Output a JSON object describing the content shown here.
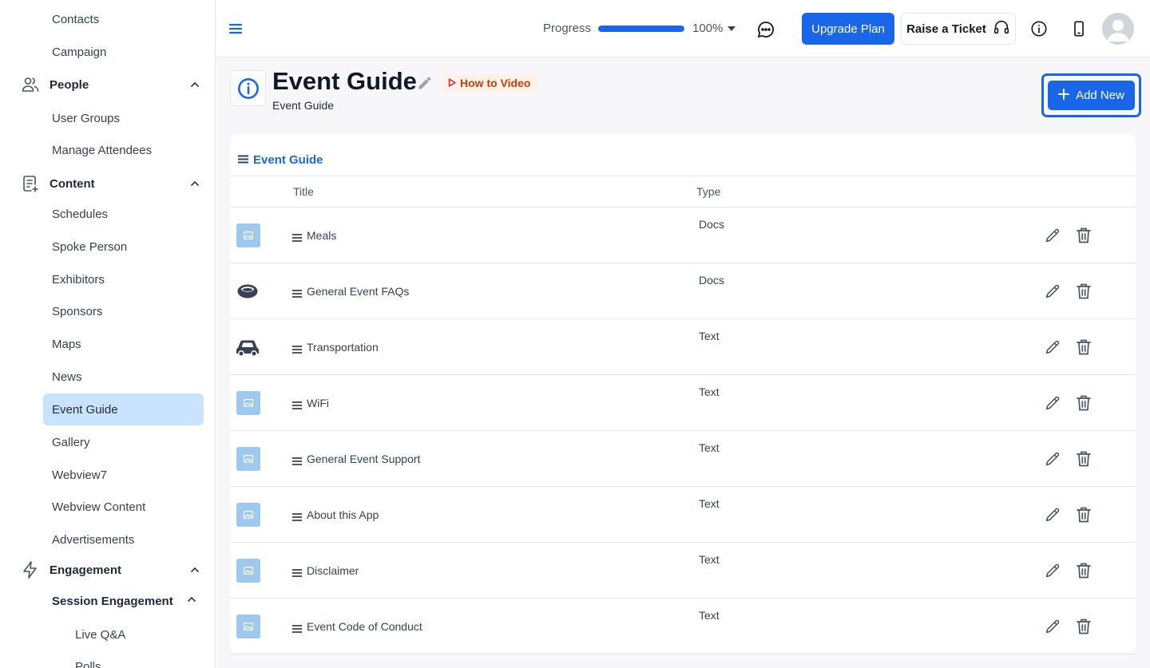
{
  "sidebar": {
    "top_items": [
      "Contacts",
      "Campaign"
    ],
    "people": {
      "label": "People",
      "icon": "users-icon",
      "items": [
        "User Groups",
        "Manage Attendees"
      ]
    },
    "content": {
      "label": "Content",
      "icon": "document-add-icon",
      "items": [
        "Schedules",
        "Spoke Person",
        "Exhibitors",
        "Sponsors",
        "Maps",
        "News",
        "Event Guide",
        "Gallery",
        "Webview7",
        "Webview Content",
        "Advertisements"
      ],
      "active": "Event Guide"
    },
    "engagement": {
      "label": "Engagement",
      "icon": "lightning-icon",
      "sub": {
        "label": "Session Engagement",
        "items": [
          "Live Q&A",
          "Polls"
        ]
      }
    }
  },
  "topbar": {
    "progress_label": "Progress",
    "progress_value": 100,
    "progress_text": "100%",
    "upgrade_label": "Upgrade Plan",
    "ticket_label": "Raise a Ticket"
  },
  "page": {
    "title": "Event Guide",
    "subtitle": "Event Guide",
    "how_to_label": "How to Video",
    "add_new_label": "Add New"
  },
  "table": {
    "section_title": "Event Guide",
    "columns": {
      "title": "Title",
      "type": "Type"
    },
    "rows": [
      {
        "title": "Meals",
        "type": "Docs",
        "icon": "image-placeholder-icon"
      },
      {
        "title": "General Event FAQs",
        "type": "Docs",
        "icon": "ring-icon"
      },
      {
        "title": "Transportation",
        "type": "Text",
        "icon": "car-icon"
      },
      {
        "title": "WiFi",
        "type": "Text",
        "icon": "image-placeholder-icon"
      },
      {
        "title": "General Event Support",
        "type": "Text",
        "icon": "image-placeholder-icon"
      },
      {
        "title": "About this App",
        "type": "Text",
        "icon": "image-placeholder-icon"
      },
      {
        "title": "Disclaimer",
        "type": "Text",
        "icon": "image-placeholder-icon"
      },
      {
        "title": "Event Code of Conduct",
        "type": "Text",
        "icon": "image-placeholder-icon"
      }
    ]
  },
  "colors": {
    "primary": "#1a66e8",
    "active_bg": "#c8e3fb",
    "how_to": "#c2410c"
  }
}
